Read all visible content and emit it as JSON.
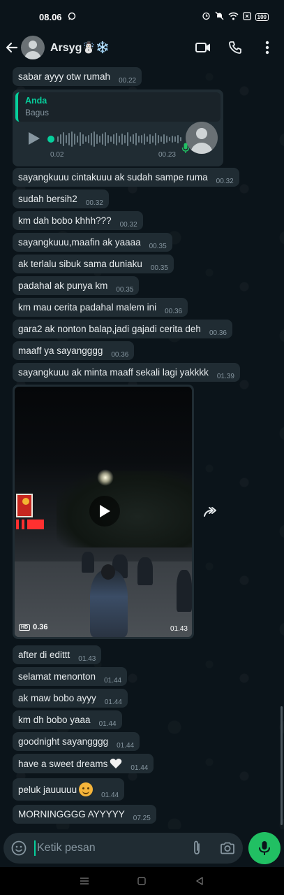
{
  "status_bar": {
    "time": "08.06",
    "battery": "100"
  },
  "header": {
    "contact_name": "Arsyg☃️❄️"
  },
  "messages_top": [
    {
      "text": "sabar ayyy otw rumah",
      "time": "00.22"
    }
  ],
  "voice_note": {
    "quote_author": "Anda",
    "quote_text": "Bagus",
    "duration": "0.02",
    "time": "00.23"
  },
  "messages_mid": [
    {
      "text": "sayangkuuu cintakuuu ak sudah sampe ruma",
      "time": "00.32"
    },
    {
      "text": "sudah bersih2",
      "time": "00.32"
    },
    {
      "text": "km dah bobo khhh???",
      "time": "00.32"
    },
    {
      "text": "sayangkuuu,maafin ak yaaaa",
      "time": "00.35"
    },
    {
      "text": "ak terlalu sibuk sama duniaku",
      "time": "00.35"
    },
    {
      "text": "padahal ak punya km",
      "time": "00.35"
    },
    {
      "text": "km mau cerita padahal malem ini",
      "time": "00.36"
    },
    {
      "text": "gara2 ak nonton balap,jadi gajadi cerita deh",
      "time": "00.36"
    },
    {
      "text": "maaff ya sayangggg",
      "time": "00.36"
    },
    {
      "text": "sayangkuuu ak minta maaff sekali lagi yakkkk",
      "time": "01.39"
    }
  ],
  "video": {
    "hd_label": "HD",
    "duration": "0.36",
    "time": "01.43"
  },
  "messages_bottom": [
    {
      "text": "after di edittt",
      "time": "01.43"
    },
    {
      "text": "selamat menonton",
      "time": "01.44"
    },
    {
      "text": "ak maw bobo ayyy",
      "time": "01.44"
    },
    {
      "text": "km dh bobo yaaa",
      "time": "01.44"
    },
    {
      "text": "goodnight sayangggg",
      "time": "01.44"
    },
    {
      "text": "have a sweet dreams",
      "time": "01.44"
    },
    {
      "text": "peluk jauuuuu",
      "time": "01.44"
    },
    {
      "text": "MORNINGGGG AYYYYY",
      "time": "07.25"
    }
  ],
  "composer": {
    "placeholder": "Ketik pesan"
  },
  "colors": {
    "accent": "#21c063",
    "bubble": "#202c33",
    "background": "#0b141a",
    "quote_accent": "#06cf9c"
  }
}
